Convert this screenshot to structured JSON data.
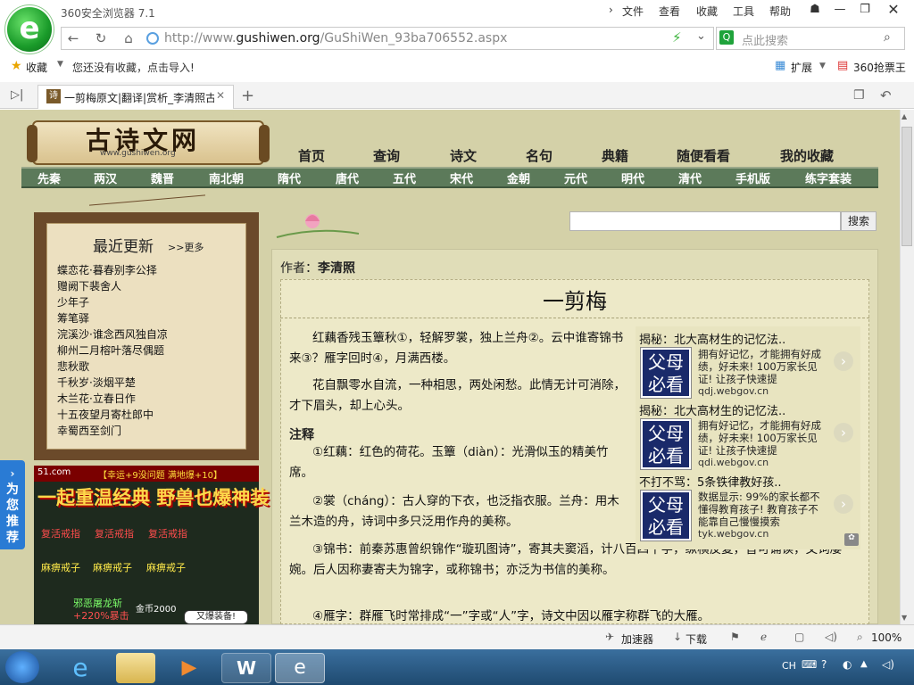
{
  "browser": {
    "app_title": "360安全浏览器 7.1",
    "menu": [
      "文件",
      "查看",
      "收藏",
      "工具",
      "帮助"
    ],
    "url_prefix": "http://www.",
    "url_domain": "gushiwen.org",
    "url_path": "/GuShiWen_93ba706552.aspx",
    "search_placeholder": "点此搜索",
    "fav_label": "收藏",
    "fav_hint": "您还没有收藏，点击导入!",
    "extend_label": "扩展",
    "ticket_label": "360抢票王",
    "tab_title": "一剪梅原文|翻译|赏析_李清照古",
    "status": {
      "accelerator": "加速器",
      "download": "下载",
      "zoom": "100%"
    }
  },
  "site": {
    "logo_text": "古诗文网",
    "logo_url": "www.gushiwen.org",
    "top_nav": [
      "首页",
      "查询",
      "诗文",
      "名句",
      "典籍",
      "随便看看",
      "我的收藏"
    ],
    "dynasty_nav": [
      "先秦",
      "两汉",
      "魏晋",
      "南北朝",
      "隋代",
      "唐代",
      "五代",
      "宋代",
      "金朝",
      "元代",
      "明代",
      "清代",
      "手机版",
      "练字套装"
    ],
    "search_button": "搜索",
    "recent_title": "最近更新",
    "recent_more": ">>更多",
    "recent_items": [
      "蝶恋花·暮春别李公择",
      "赠阙下裴舍人",
      "少年子",
      "筹笔驿",
      "浣溪沙·谁念西风独自凉",
      "柳州二月榕叶落尽偶题",
      "悲秋歌",
      "千秋岁·淡烟平楚",
      "木兰花·立春日作",
      "十五夜望月寄杜郎中",
      "幸蜀西至剑门"
    ],
    "side_tab": "为您推荐"
  },
  "ad_banner": {
    "domain": "51.com",
    "tag": "【幸运+9没问题 满地爆+10】",
    "headline": "一起重温经典 野兽也爆神装",
    "labels": [
      "复活戒指",
      "复活戒指",
      "复活戒指",
      "麻痹戒子",
      "麻痹戒子",
      "麻痹戒子"
    ],
    "loot1": "邪恶屠龙斩",
    "loot2": "+220%暴击",
    "gold": "金币2000",
    "bubble": "又爆装备!"
  },
  "poem": {
    "author_label": "作者：",
    "author": "李清照",
    "title": "一剪梅",
    "para1": "红藕香残玉簟秋①，轻解罗裳，独上兰舟②。云中谁寄锦书来③？雁字回时④，月满西楼。",
    "para2": "花自飘零水自流，一种相思，两处闲愁。此情无计可消除，才下眉头，却上心头。",
    "notes_heading": "注释",
    "note1": "①红藕：红色的荷花。玉簟（diàn）：光滑似玉的精美竹席。",
    "note2": "②裳（cháng）：古人穿的下衣，也泛指衣服。兰舟：用木兰木造的舟，诗词中多只泛用作舟的美称。",
    "note3": "③锦书：前秦苏惠曾织锦作“璇玑图诗”，寄其夫窦滔，计八百四十字，纵横反复，皆可诵读，文词凄婉。后人因称妻寄夫为锦字，或称锦书；亦泛为书信的美称。",
    "note4": "④雁字：群雁飞时常排成“一”字或“人”字，诗文中因以雁字称群飞的大雁。"
  },
  "ads": [
    {
      "title": "揭秘：北大高材生的记忆法..",
      "thumb": "父母必看",
      "desc": "拥有好记忆，才能拥有好成绩，好未来! 100万家长见证! 让孩子快速提",
      "url": "qdj.webgov.cn"
    },
    {
      "title": "揭秘：北大高材生的记忆法..",
      "thumb": "父母必看",
      "desc": "拥有好记忆，才能拥有好成绩，好未来! 100万家长见证! 让孩子快速提",
      "url": "qdi.webgov.cn"
    },
    {
      "title": "不打不骂：5条铁律教好孩..",
      "thumb": "父母必看",
      "desc": "数据显示: 99%的家长都不懂得教育孩子! 教育孩子不能靠自己慢慢摸索",
      "url": "tyk.webgov.cn"
    }
  ],
  "taskbar": {
    "ime": "CH"
  }
}
